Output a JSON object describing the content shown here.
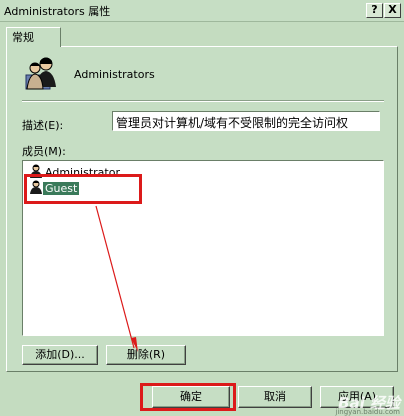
{
  "window": {
    "title": "Administrators 属性",
    "help_button": "?",
    "close_button": "X"
  },
  "tabs": [
    {
      "label": "常规"
    }
  ],
  "group": {
    "name": "Administrators",
    "icon": "group-users-icon"
  },
  "description": {
    "label": "描述(E):",
    "value": "管理员对计算机/域有不受限制的完全访问权"
  },
  "members": {
    "label": "成员(M):",
    "items": [
      {
        "name": "Administrator",
        "icon": "user-icon",
        "selected": false
      },
      {
        "name": "Guest",
        "icon": "user-icon",
        "selected": true
      }
    ]
  },
  "buttons": {
    "add": "添加(D)...",
    "remove": "删除(R)",
    "ok": "确定",
    "cancel": "取消",
    "apply": "应用(A)"
  },
  "annotation": {
    "highlight_color": "#dc1a1a"
  },
  "watermark": {
    "text": "Bai 经验",
    "url": "jingyan.baidu.com"
  }
}
